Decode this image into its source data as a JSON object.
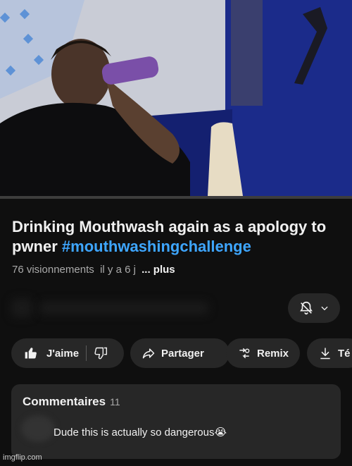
{
  "video": {
    "progress_fraction": 0.0
  },
  "title": {
    "text": "Drinking Mouthwash again as a apology to pwner ",
    "hashtag": "#mouthwashingchallenge"
  },
  "meta": {
    "views": "76 visionnements",
    "time": "il y a 6 j",
    "more": "... plus"
  },
  "actions": {
    "like_label": "J'aime",
    "share_label": "Partager",
    "remix_label": "Remix",
    "download_label": "Té"
  },
  "comments": {
    "title": "Commentaires",
    "count": "11",
    "first_comment": "Dude this is actually so dangerous😭"
  },
  "watermark": "imgflip.com",
  "colors": {
    "background": "#0f0f0f",
    "pill": "#272727",
    "hashtag": "#3ea6ff",
    "muted_text": "#aaaaaa"
  },
  "icons": [
    "thumbs-up-icon",
    "thumbs-down-icon",
    "share-icon",
    "remix-icon",
    "download-icon",
    "bell-off-icon",
    "chevron-down-icon"
  ]
}
